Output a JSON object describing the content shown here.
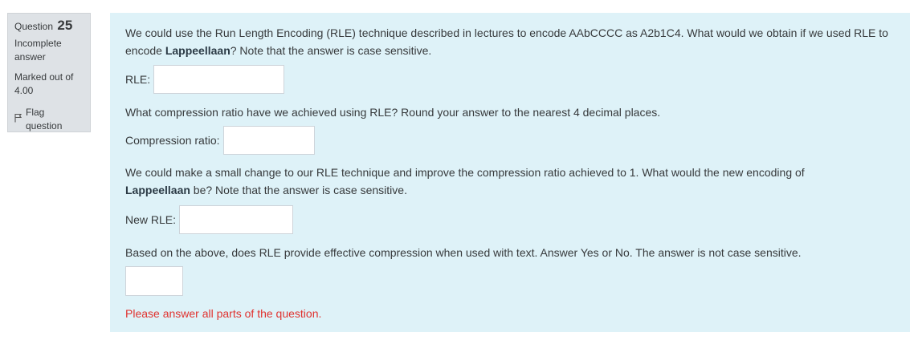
{
  "info": {
    "question_label": "Question",
    "question_number": "25",
    "state": "Incomplete answer",
    "grade": "Marked out of 4.00",
    "flag_label": "Flag question"
  },
  "q1": {
    "text_before": "We could use the Run Length Encoding (RLE) technique described in lectures to encode AAbCCCC as A2b1C4. What would we obtain if we used RLE to encode ",
    "bold": "Lappeellaan",
    "text_after": "? Note that the answer is case sensitive.",
    "input_label": "RLE:",
    "input_value": ""
  },
  "q2": {
    "text": "What compression ratio have we achieved using RLE? Round your answer to the nearest 4 decimal places.",
    "input_label": "Compression ratio:",
    "input_value": ""
  },
  "q3": {
    "text_before": "We could make a small change to our RLE technique and improve the compression ratio achieved to 1. What would the new encoding of ",
    "bold": "Lappeellaan",
    "text_after": " be? Note that the answer is case sensitive.",
    "input_label": "New RLE:",
    "input_value": ""
  },
  "q4": {
    "text": "Based on the above, does RLE provide effective compression when used with text. Answer Yes or No. The answer is not case sensitive.",
    "input_value": ""
  },
  "validation_message": "Please answer all parts of the question.",
  "colors": {
    "content_bg": "#def2f8",
    "info_bg": "#dee2e6",
    "error": "#e0322f"
  }
}
